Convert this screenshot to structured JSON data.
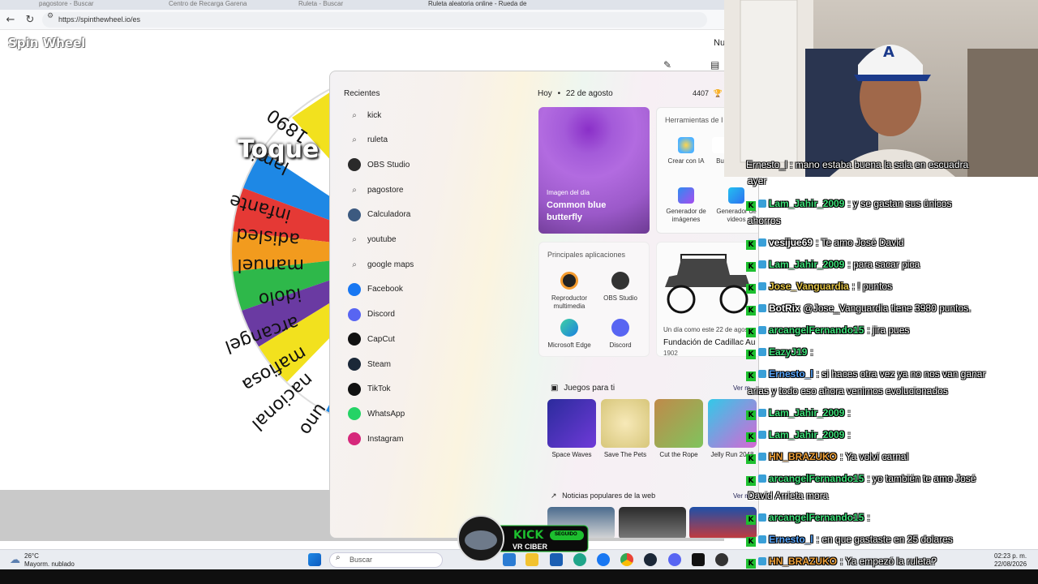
{
  "browser": {
    "tabs": [
      "pagostore - Buscar",
      "Centro de Recarga Garena",
      "Ruleta - Buscar",
      "Ruleta aleatoria online - Rueda de"
    ],
    "url": "https://spinthewheel.io/es"
  },
  "page": {
    "logo": "Spin Wheel",
    "menu_partial": "Nu",
    "wheel_overlay_text": "Toque",
    "wheel_labels": [
      "1890",
      "lamin",
      "infante",
      "adisled",
      "manuel",
      "idolo",
      "arcangel",
      "mafiosa",
      "nacional",
      "uno"
    ]
  },
  "start_menu": {
    "recent_title": "Recientes",
    "recent_items": [
      {
        "label": "kick",
        "icon": "search-icon"
      },
      {
        "label": "ruleta",
        "icon": "search-icon"
      },
      {
        "label": "OBS Studio",
        "icon": "obs-icon"
      },
      {
        "label": "pagostore",
        "icon": "search-icon"
      },
      {
        "label": "Calculadora",
        "icon": "calculator-icon"
      },
      {
        "label": "youtube",
        "icon": "search-icon"
      },
      {
        "label": "google maps",
        "icon": "search-icon"
      },
      {
        "label": "Facebook",
        "icon": "facebook-icon"
      },
      {
        "label": "Discord",
        "icon": "discord-icon"
      },
      {
        "label": "CapCut",
        "icon": "capcut-icon"
      },
      {
        "label": "Steam",
        "icon": "steam-icon"
      },
      {
        "label": "TikTok",
        "icon": "tiktok-icon"
      },
      {
        "label": "WhatsApp",
        "icon": "whatsapp-icon"
      },
      {
        "label": "Instagram",
        "icon": "instagram-icon"
      }
    ],
    "today_label": "Hoy",
    "today_date": "22 de agosto",
    "points": "4407",
    "image_of_day_label": "Imagen del día",
    "image_of_day_title": "Common blue butterfly",
    "tools_title": "Herramientas de I",
    "tools": [
      "Crear con IA",
      "Bu",
      "Generador de imágenes",
      "Generador de videos"
    ],
    "apps_title": "Principales aplicaciones",
    "apps": [
      "Reproductor multimedia",
      "OBS Studio",
      "Microsoft Edge",
      "Discord"
    ],
    "history_caption": "Un día como este 22 de agos",
    "history_title": "Fundación de Cadillac Au",
    "history_year": "1902",
    "games_title": "Juegos para ti",
    "see_more": "Ver m",
    "games": [
      "Space Waves",
      "Save The Pets",
      "Cut the Rope",
      "Jelly Run 2048"
    ],
    "news_title": "Noticias populares de la web",
    "see_more_news": "Ver m"
  },
  "chat": {
    "partial_top": "Ernesto_l : mano estaba buena la sala en escuadra",
    "partial_top_wrap": "ayer",
    "messages": [
      {
        "user": "Lam_Jahir_2009",
        "color": "#3ee07a",
        "text": ": y se gastan sus únicos",
        "wrap": "ahorros"
      },
      {
        "user": "vesijue69",
        "color": "#ffffff",
        "text": ": Te amo José David",
        "wrap": ""
      },
      {
        "user": "Lam_Jahir_2009",
        "color": "#3ee07a",
        "text": ": para sacar pica",
        "wrap": ""
      },
      {
        "user": "Jose_Vanguardia",
        "color": "#e8c84a",
        "text": ": ! puntos",
        "wrap": ""
      },
      {
        "user": "BotRix",
        "color": "#ffffff",
        "text": "@Jose_Vanguardia tiene 3980 puntos.",
        "wrap": ""
      },
      {
        "user": "arcangelFernando15",
        "color": "#3ee07a",
        "text": ": jira pues",
        "wrap": ""
      },
      {
        "user": "EazyJ19",
        "color": "#3ee07a",
        "text": ":",
        "wrap": ""
      },
      {
        "user": "Ernesto_l",
        "color": "#5aa8ff",
        "text": ": si haces otra vez ya no nos van ganar",
        "wrap": "arias y todo eso ahora venimos evolucionados"
      },
      {
        "user": "Lam_Jahir_2009",
        "color": "#3ee07a",
        "text": ":",
        "wrap": ""
      },
      {
        "user": "Lam_Jahir_2009",
        "color": "#3ee07a",
        "text": ":",
        "wrap": ""
      },
      {
        "user": "HN_BRAZUKO",
        "color": "#f0a23a",
        "text": ": Ya volví carnal",
        "wrap": ""
      },
      {
        "user": "arcangelFernando15",
        "color": "#3ee07a",
        "text": ": yo también te amo José",
        "wrap": "David Arrieta mora"
      },
      {
        "user": "arcangelFernando15",
        "color": "#3ee07a",
        "text": ":",
        "wrap": ""
      },
      {
        "user": "Ernesto_l",
        "color": "#5aa8ff",
        "text": ": en que gastaste en 25 dolares",
        "wrap": ""
      },
      {
        "user": "HN_BRAZUKO",
        "color": "#f0a23a",
        "text": ": Ya empezó la ruleta?",
        "wrap": ""
      }
    ]
  },
  "kick_badge": {
    "brand": "KICK",
    "channel": "VR CIBER",
    "status": "SEGUIDO"
  },
  "taskbar": {
    "temperature": "26°C",
    "weather": "Mayorm. nublado",
    "search_placeholder": "Buscar",
    "time": "02:23 p. m.",
    "date": "22/08/2026"
  }
}
